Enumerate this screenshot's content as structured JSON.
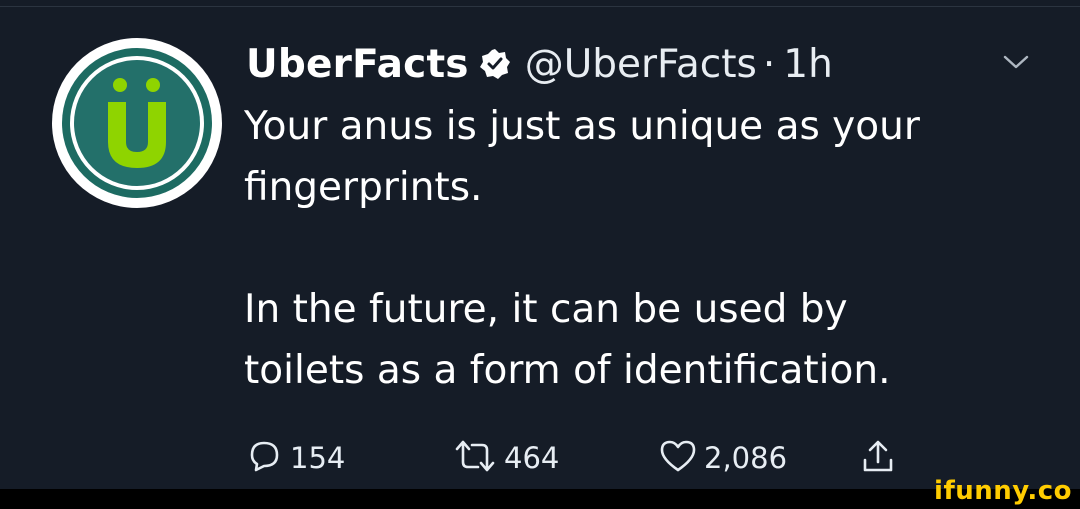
{
  "tweet": {
    "display_name": "UberFacts",
    "handle": "@UberFacts",
    "separator": "·",
    "time": "1h",
    "text": "Your anus is just as unique as your\nfingerprints.\n\nIn the future, it can be used by\ntoilets as a form of identification.",
    "avatar_letter": "Ü",
    "icons": {
      "verified": "verified-badge-icon",
      "more": "chevron-down-icon",
      "reply": "reply-icon",
      "retweet": "retweet-icon",
      "like": "heart-icon",
      "share": "share-icon"
    },
    "stats": {
      "replies": "154",
      "retweets": "464",
      "likes": "2,086"
    }
  },
  "watermark": "ifunny.co",
  "colors": {
    "background": "#151c27",
    "avatar_green": "#23706a",
    "avatar_letter": "#8fd400",
    "watermark": "#ffcc00"
  }
}
